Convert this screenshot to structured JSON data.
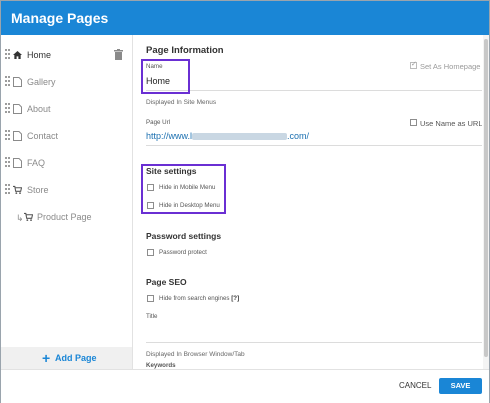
{
  "dialog": {
    "title": "Manage Pages"
  },
  "sidebar": {
    "items": [
      {
        "label": "Home",
        "icon": "home-icon"
      },
      {
        "label": "Gallery",
        "icon": "page-icon"
      },
      {
        "label": "About",
        "icon": "page-icon"
      },
      {
        "label": "Contact",
        "icon": "page-icon"
      },
      {
        "label": "FAQ",
        "icon": "page-icon"
      },
      {
        "label": "Store",
        "icon": "cart-icon"
      },
      {
        "label": "Product Page",
        "icon": "cart-icon"
      }
    ],
    "add_page": "Add Page"
  },
  "page_info": {
    "heading": "Page Information",
    "name_label": "Name",
    "name_value": "Home",
    "name_hint": "Displayed In Site Menus",
    "set_as_homepage": "Set As Homepage",
    "url_label": "Page Url",
    "url_value": "http://www.l",
    "url_suffix": ".com/",
    "use_name_as_url": "Use Name as URL"
  },
  "site_settings": {
    "heading": "Site settings",
    "hide_mobile": "Hide in Mobile Menu",
    "hide_desktop": "Hide in Desktop Menu"
  },
  "password_settings": {
    "heading": "Password settings",
    "protect": "Password protect"
  },
  "page_seo": {
    "heading": "Page SEO",
    "hide_search": "Hide from search engines",
    "help": "[?]",
    "title_label": "Title",
    "title_hint": "Displayed In Browser Window/Tab",
    "keywords_label": "Keywords"
  },
  "footer": {
    "cancel": "CANCEL",
    "save": "SAVE"
  },
  "colors": {
    "accent": "#1a86d6",
    "highlight": "#6a2fd3"
  }
}
